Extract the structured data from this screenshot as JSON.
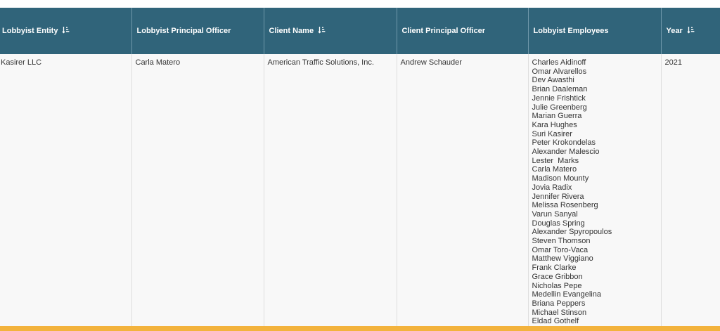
{
  "table": {
    "headers": [
      {
        "label": "Lobbyist Entity",
        "sortable": true
      },
      {
        "label": "Lobbyist Principal Officer",
        "sortable": false
      },
      {
        "label": "Client Name",
        "sortable": true
      },
      {
        "label": "Client Principal Officer",
        "sortable": false
      },
      {
        "label": "Lobbyist Employees",
        "sortable": false
      },
      {
        "label": "Year",
        "sortable": true
      }
    ],
    "rows": [
      {
        "lobbyist_entity": "Kasirer LLC",
        "lobbyist_principal_officer": "Carla Matero",
        "client_name": "American Traffic Solutions, Inc.",
        "client_principal_officer": "Andrew Schauder",
        "lobbyist_employees": [
          "Charles Aidinoff",
          "Omar Alvarellos",
          "Dev Awasthi",
          "Brian Daaleman",
          "Jennie Frishtick",
          "Julie Greenberg",
          "Marian Guerra",
          "Kara Hughes",
          "Suri Kasirer",
          "Peter Krokondelas",
          "Alexander Malescio",
          "Lester  Marks",
          "Carla Matero",
          "Madison Mounty",
          "Jovia Radix",
          "Jennifer Rivera",
          "Melissa Rosenberg",
          "Varun Sanyal",
          "Douglas Spring",
          "Alexander Spyropoulos",
          "Steven Thomson",
          "Omar Toro-Vaca",
          "Matthew Viggiano",
          "Frank Clarke",
          "Grace Gribbon",
          "Nicholas Pepe",
          "Medellin Evangelina",
          "Briana Peppers",
          "Michael Stinson",
          "Eldad Gothelf"
        ],
        "year": "2021"
      }
    ]
  },
  "colors": {
    "header_bg": "#30647a",
    "header_text": "#ffffff",
    "row_bg": "#f8f8f8",
    "accent_bar": "#f3b33d"
  },
  "icons": {
    "sort": "sort-descending-icon"
  }
}
